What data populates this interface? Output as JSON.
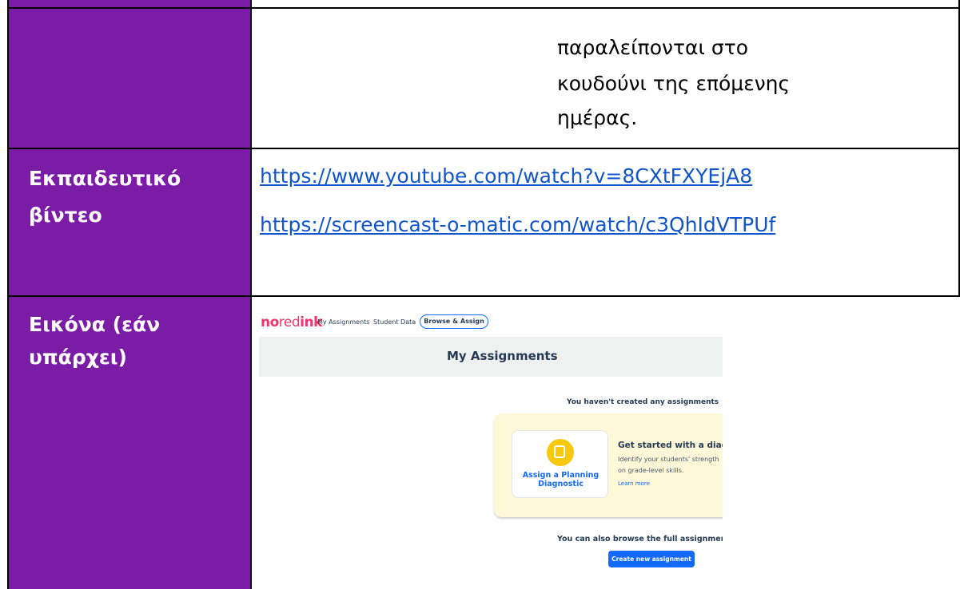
{
  "rows": [
    {
      "label_lines": [],
      "content_lines": [
        "παραλείπονται στο",
        "κουδούνι της επόμενης",
        "ημέρας."
      ]
    },
    {
      "label_lines": [
        "Εκπαιδευτικό",
        "βίντεο"
      ],
      "links": [
        "https://www.youtube.com/watch?v=8CXtFXYEjA8",
        "https://screencast-o-matic.com/watch/c3QhIdVTPUf"
      ]
    },
    {
      "label_lines": [
        "Εικόνα (εάν",
        "υπάρχει)"
      ]
    }
  ],
  "screenshot": {
    "logo": {
      "no": "no",
      "red": "red",
      "ink": "ink"
    },
    "nav": [
      "My Assignments",
      "Student Data"
    ],
    "nav_button": "Browse & Assign",
    "page_title": "My Assignments",
    "empty_message": "You haven't created any assignments",
    "card_label_lines": [
      "Assign a Planning",
      "Diagnostic"
    ],
    "panel_title": "Get started with a diagnos",
    "panel_desc_lines": [
      "Identify your students' strength",
      "on grade-level skills."
    ],
    "panel_link": "Learn more",
    "browse_text": "You can also browse the full assignment li",
    "create_button": "Create new assignment"
  },
  "colors": {
    "label_bg": "#7B1CA7",
    "link": "#1155CC",
    "accent": "#146AFF",
    "panel": "#FEF8D9",
    "icon": "#F6C90E"
  }
}
